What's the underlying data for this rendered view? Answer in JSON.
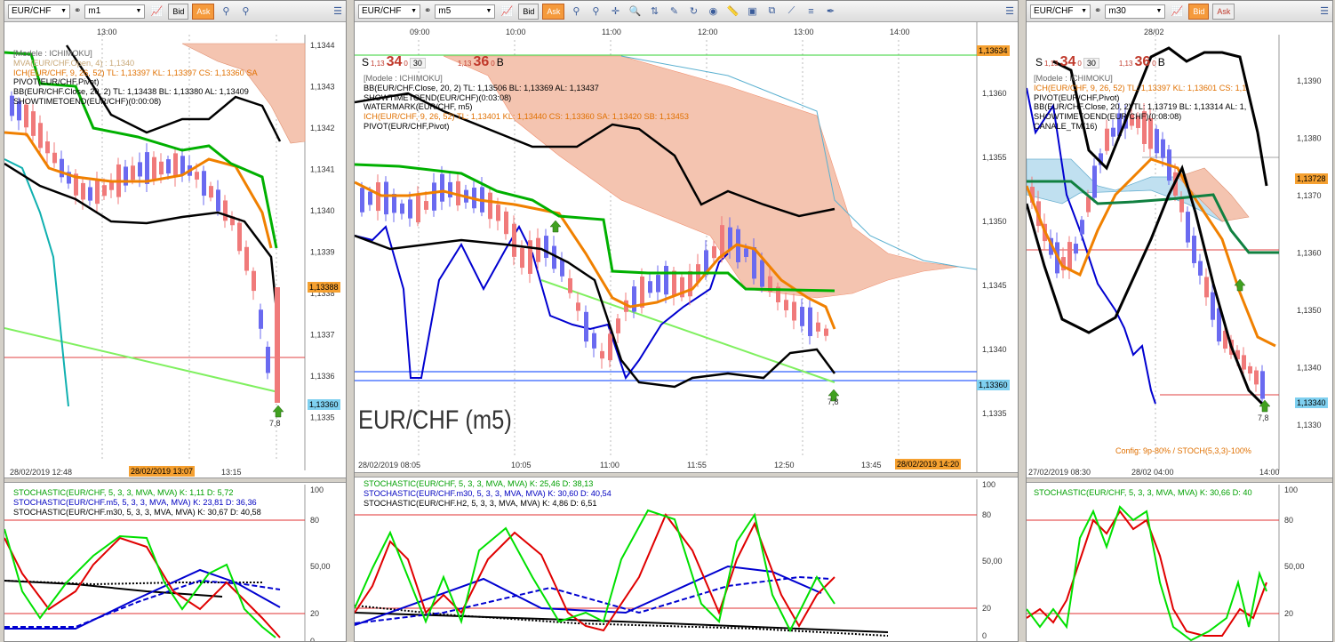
{
  "panels": [
    {
      "symbol": "EUR/CHF",
      "timeframe": "m1",
      "bid_label": "Bid",
      "ask_label": "Ask",
      "top_time": "13:00",
      "legend": [
        {
          "text": "[Modele : ICHIMOKU]",
          "color": "#666666"
        },
        {
          "text": "MVA(EUR/CHF.Open, 4) : 1,1340",
          "color": "#c8a878"
        },
        {
          "text": "ICH(EUR/CHF, 9, 26, 52) TL: 1,13397  KL: 1,13397  CS: 1,13360  SA",
          "color": "#e07000"
        },
        {
          "text": "PIVOT(EUR/CHF,Pivot)",
          "color": "#000000"
        },
        {
          "text": "BB(EUR/CHF.Close, 20, 2)  TL: 1,13438  BL: 1,13380  AL: 1,13409",
          "color": "#000000"
        },
        {
          "text": "SHOWTIMETOEND(EUR/CHF)(0:00:08)",
          "color": "#000000"
        }
      ],
      "y_ticks": [
        "1,1344",
        "1,1343",
        "1,1342",
        "1,1341",
        "1,1340",
        "1,1339",
        "1,1338",
        "1,1337",
        "1,1336",
        "1,1335"
      ],
      "price_tag_current": "1,13388",
      "price_tag_low": "1,13360",
      "arrow_value": "7,8",
      "x_labels": [
        "28/02/2019 12:48",
        "13:15"
      ],
      "x_highlight": "28/02/2019 13:07",
      "stoch_legend": [
        {
          "text": "STOCHASTIC(EUR/CHF, 5, 3, 3, MVA, MVA)  K: 1,11  D: 5,72",
          "color": "#00a000"
        },
        {
          "text": "STOCHASTIC(EUR/CHF.m5, 5, 3, 3, MVA, MVA)  K: 23,81  D: 36,36",
          "color": "#0000c0"
        },
        {
          "text": "STOCHASTIC(EUR/CHF.m30, 5, 3, 3, MVA, MVA)  K: 30,67  D: 40,58",
          "color": "#000000"
        }
      ],
      "stoch_ticks": [
        "100",
        "80",
        "50,00",
        "20",
        "0"
      ]
    },
    {
      "symbol": "EUR/CHF",
      "timeframe": "m5",
      "bid_label": "Bid",
      "ask_label": "Ask",
      "top_times": [
        "09:00",
        "10:00",
        "11:00",
        "12:00",
        "13:00",
        "14:00"
      ],
      "sell_label": "S",
      "sell_small": "1,13",
      "sell_big": "34",
      "sell_sup": "0",
      "lot": "30",
      "buy_small": "1,13",
      "buy_big": "36",
      "buy_sup": "0",
      "buy_label": "B",
      "legend": [
        {
          "text": "[Modele : ICHIMOKU]",
          "color": "#666666"
        },
        {
          "text": "BB(EUR/CHF.Close, 20, 2)  TL: 1,13506  BL: 1,13369  AL: 1,13437",
          "color": "#000000"
        },
        {
          "text": "SHOWTIMETOEND(EUR/CHF)(0:03:08)",
          "color": "#000000"
        },
        {
          "text": "WATERMARK(EUR/CHF, m5)",
          "color": "#000000"
        },
        {
          "text": "ICH(EUR/CHF, 9, 26, 52)  TL: 1,13401  KL: 1,13440  CS: 1,13360  SA: 1,13420  SB: 1,13453",
          "color": "#e07000"
        },
        {
          "text": "PIVOT(EUR/CHF,Pivot)",
          "color": "#000000"
        }
      ],
      "y_ticks": [
        "1,1360",
        "1,1355",
        "1,1350",
        "1,1345",
        "1,1340",
        "1,1335"
      ],
      "price_tag_top": "1,13634",
      "price_tag_low": "1,13360",
      "watermark": "EUR/CHF (m5)",
      "arrow_value": "7,8",
      "x_labels": [
        "28/02/2019 08:05",
        "10:05",
        "11:00",
        "11:55",
        "12:50",
        "13:45"
      ],
      "x_highlight": "28/02/2019 14:20",
      "stoch_legend": [
        {
          "text": "STOCHASTIC(EUR/CHF, 5, 3, 3, MVA, MVA)  K: 25,46  D: 38,13",
          "color": "#00a000"
        },
        {
          "text": "STOCHASTIC(EUR/CHF.m30, 5, 3, 3, MVA, MVA)  K: 30,60  D: 40,54",
          "color": "#0000c0"
        },
        {
          "text": "STOCHASTIC(EUR/CHF.H2, 5, 3, 3, MVA, MVA)  K: 4,86  D: 6,51",
          "color": "#000000"
        }
      ],
      "stoch_ticks": [
        "100",
        "80",
        "50,00",
        "20",
        "0"
      ]
    },
    {
      "symbol": "EUR/CHF",
      "timeframe": "m30",
      "bid_label": "Bid",
      "ask_label": "Ask",
      "top_time": "28/02",
      "sell_label": "S",
      "sell_small": "1,13",
      "sell_big": "34",
      "sell_sup": "0",
      "lot": "30",
      "buy_small": "1,13",
      "buy_big": "36",
      "buy_sup": "0",
      "buy_label": "B",
      "legend": [
        {
          "text": "[Modele : ICHIMOKU]",
          "color": "#666666"
        },
        {
          "text": "ICH(EUR/CHF, 9, 26, 52)  TL: 1,13397  KL: 1,13601  CS: 1,1",
          "color": "#e07000"
        },
        {
          "text": "PIVOT(EUR/CHF,Pivot)",
          "color": "#000000"
        },
        {
          "text": "BB(EUR/CHF.Close, 20, 2)  TL: 1,13719  BL: 1,13314  AL: 1,",
          "color": "#000000"
        },
        {
          "text": "SHOWTIMETOEND(EUR/CHF)(0:08:08)",
          "color": "#000000"
        },
        {
          "text": "CANALE_TM(16)",
          "color": "#000000"
        }
      ],
      "y_ticks": [
        "1,1390",
        "1,1380",
        "1,1370",
        "1,1360",
        "1,1350",
        "1,1340",
        "1,1330"
      ],
      "price_tag_current": "1,13728",
      "price_tag_low": "1,13340",
      "arrow_value": "7,8",
      "config_text": "Config: 9p-80% / STOCH(5,3,3)-100%",
      "x_labels": [
        "27/02/2019 08:30",
        "28/02 04:00",
        "14:00"
      ],
      "stoch_legend": [
        {
          "text": "STOCHASTIC(EUR/CHF, 5, 3, 3, MVA, MVA)  K: 30,66  D: 40",
          "color": "#00a000"
        }
      ],
      "stoch_ticks": [
        "100",
        "80",
        "50,00",
        "20"
      ]
    }
  ],
  "colors": {
    "bull": "#6a6af0",
    "bear": "#f07a7a",
    "kijun": "#00b000",
    "tenkan": "#f08000",
    "bollinger": "#000000",
    "pivot_blue": "#0000d0",
    "cloud": "#f4c4b0",
    "trend_green": "#80f060",
    "stoch_k": "#00e000",
    "stoch_d": "#e00000"
  }
}
